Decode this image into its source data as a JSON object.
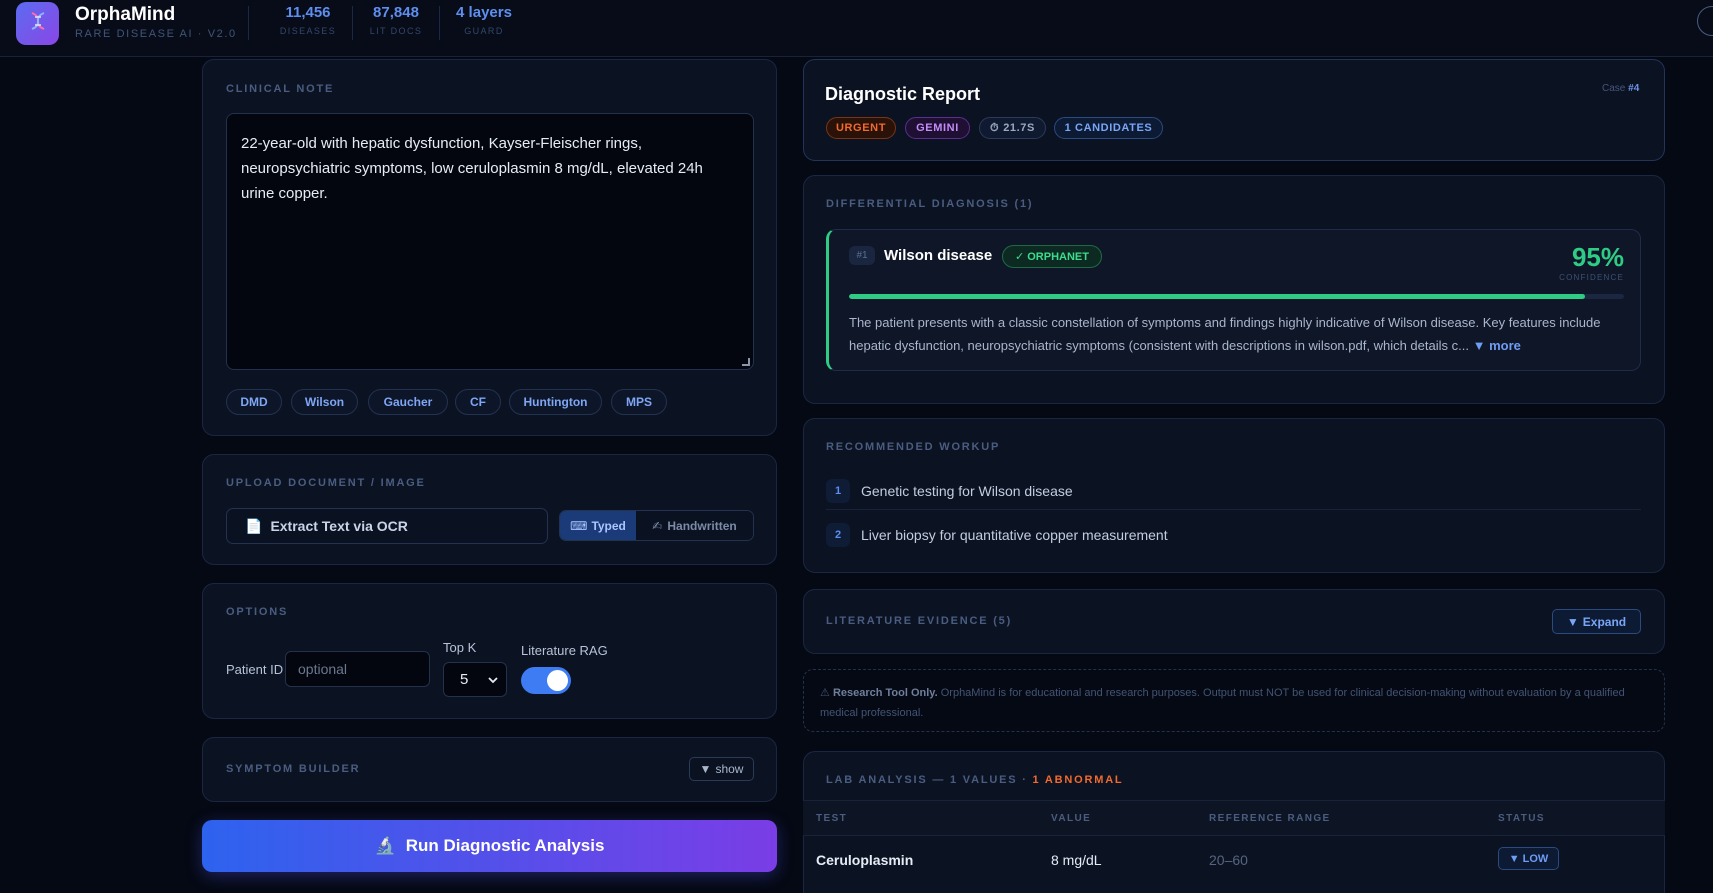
{
  "header": {
    "app_name": "OrphaMind",
    "subtitle": "RARE DISEASE AI · V2.0",
    "stats": [
      {
        "value": "11,456",
        "label": "DISEASES"
      },
      {
        "value": "87,848",
        "label": "LIT DOCS"
      },
      {
        "value": "4 layers",
        "label": "GUARD"
      }
    ]
  },
  "clinical_note": {
    "title": "CLINICAL NOTE",
    "text": "22-year-old with hepatic dysfunction, Kayser-Fleischer rings, neuropsychiatric symptoms, low ceruloplasmin 8 mg/dL, elevated 24h urine copper.",
    "chips": [
      "DMD",
      "Wilson",
      "Gaucher",
      "CF",
      "Huntington",
      "MPS"
    ]
  },
  "upload": {
    "title": "UPLOAD DOCUMENT / IMAGE",
    "ocr_button": "Extract Text via OCR",
    "mode_typed": "Typed",
    "mode_handwritten": "Handwritten"
  },
  "options": {
    "title": "OPTIONS",
    "patient_id_label": "Patient ID",
    "patient_id_placeholder": "optional",
    "top_k_label": "Top K",
    "top_k_value": "5",
    "rag_label": "Literature RAG",
    "rag_enabled": true
  },
  "symptom_builder": {
    "title": "SYMPTOM BUILDER",
    "toggle_label": "show"
  },
  "run_button": "Run Diagnostic Analysis",
  "report": {
    "title": "Diagnostic Report",
    "case_prefix": "Case",
    "case_number": "#4",
    "badges": {
      "urgency": "URGENT",
      "model": "GEMINI",
      "time": "21.7S",
      "candidates": "1 CANDIDATES"
    }
  },
  "differential": {
    "title": "DIFFERENTIAL DIAGNOSIS (1)",
    "items": [
      {
        "rank": "#1",
        "name": "Wilson disease",
        "source": "ORPHANET",
        "confidence": "95%",
        "confidence_value": 0.95,
        "confidence_label": "CONFIDENCE",
        "description": "The patient presents with a classic constellation of symptoms and findings highly indicative of Wilson disease. Key features include hepatic dysfunction, neuropsychiatric symptoms (consistent with descriptions in wilson.pdf, which details c...",
        "more_label": "more"
      }
    ]
  },
  "workup": {
    "title": "RECOMMENDED WORKUP",
    "items": [
      {
        "num": "1",
        "text": "Genetic testing for Wilson disease"
      },
      {
        "num": "2",
        "text": "Liver biopsy for quantitative copper measurement"
      }
    ]
  },
  "literature": {
    "title": "LITERATURE EVIDENCE (5)",
    "expand_label": "Expand"
  },
  "disclaimer": {
    "bold": "Research Tool Only.",
    "text": " OrphaMind is for educational and research purposes. Output must NOT be used for clinical decision-making without evaluation by a qualified medical professional."
  },
  "lab": {
    "title": "LAB ANALYSIS — 1 VALUES ·",
    "abnormal": "1 ABNORMAL",
    "columns": [
      "TEST",
      "VALUE",
      "REFERENCE RANGE",
      "STATUS"
    ],
    "rows": [
      {
        "test": "Ceruloplasmin",
        "value": "8 mg/dL",
        "range": "20–60",
        "status": "LOW"
      }
    ]
  },
  "colors": {
    "accent_blue": "#3d7cf2",
    "success_green": "#2ecc85",
    "urgent_orange": "#f26a2e",
    "gemini_purple": "#c48cf8"
  }
}
